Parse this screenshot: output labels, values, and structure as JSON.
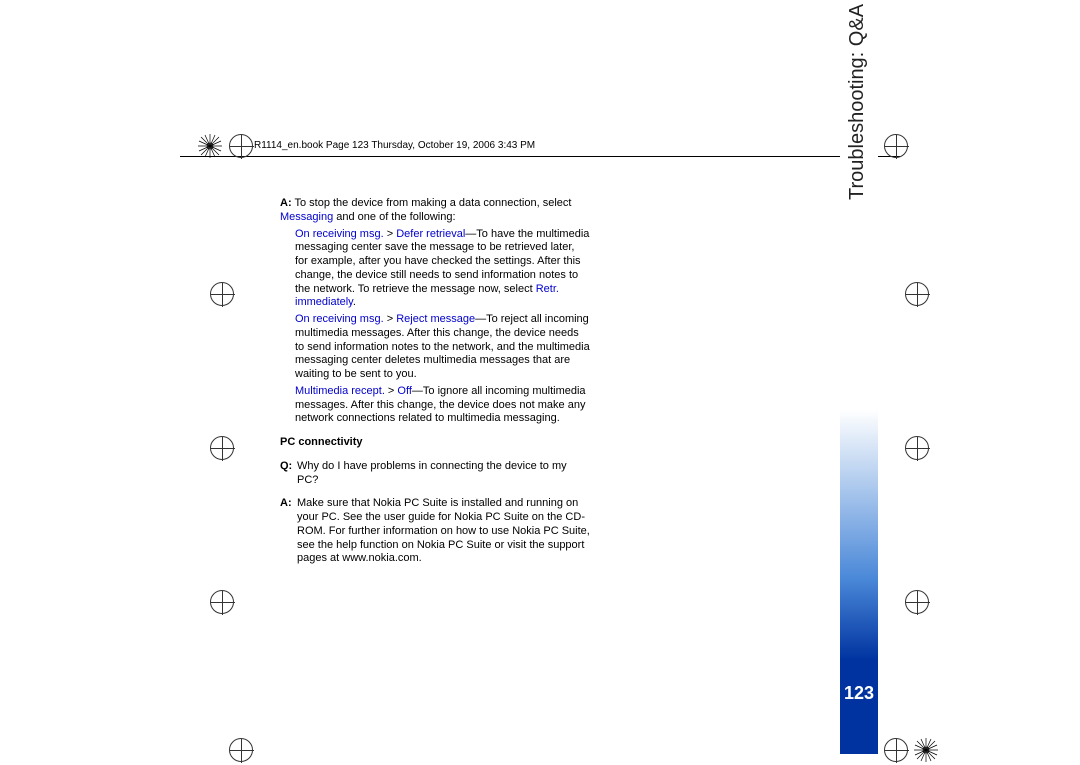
{
  "header": {
    "text": "R1114_en.book  Page 123  Thursday, October 19, 2006  3:43 PM"
  },
  "side": {
    "title": "Troubleshooting: Q&A",
    "page_number": "123"
  },
  "body": {
    "a_intro_prefix": "A:",
    "a_intro": " To stop the device from making a data connection, select ",
    "link_messaging": "Messaging",
    "a_intro_tail": " and one of the following:",
    "opt1_link1": "On receiving msg.",
    "sep_gt": " > ",
    "opt1_link2": "Defer retrieval",
    "opt1_text": "—To have the multimedia messaging center save the message to be retrieved later, for example, after you have checked the settings. After this change, the device still needs to send information notes to the network. To retrieve the message now, select ",
    "opt1_link3": "Retr. immediately",
    "opt1_period": ".",
    "opt2_link1": "On receiving msg.",
    "opt2_link2": "Reject message",
    "opt2_text": "—To reject all incoming multimedia messages. After this change, the device needs to send information notes to the network, and the multimedia messaging center deletes multimedia messages that are waiting to be sent to you.",
    "opt3_link1": "Multimedia recept.",
    "opt3_link2": "Off",
    "opt3_text": "—To ignore all incoming multimedia messages. After this change, the device does not make any network connections related to multimedia messaging.",
    "pc_heading": "PC connectivity",
    "q_prefix": "Q:",
    "q_text": " Why do I have problems in connecting the device to my PC?",
    "a2_prefix": "A:",
    "a2_text": " Make sure that Nokia PC Suite is installed and running on your PC. See the user guide for Nokia PC Suite on the CD-ROM. For further information on how to use Nokia PC Suite, see the help function on Nokia PC Suite or visit the support pages at www.nokia.com."
  }
}
